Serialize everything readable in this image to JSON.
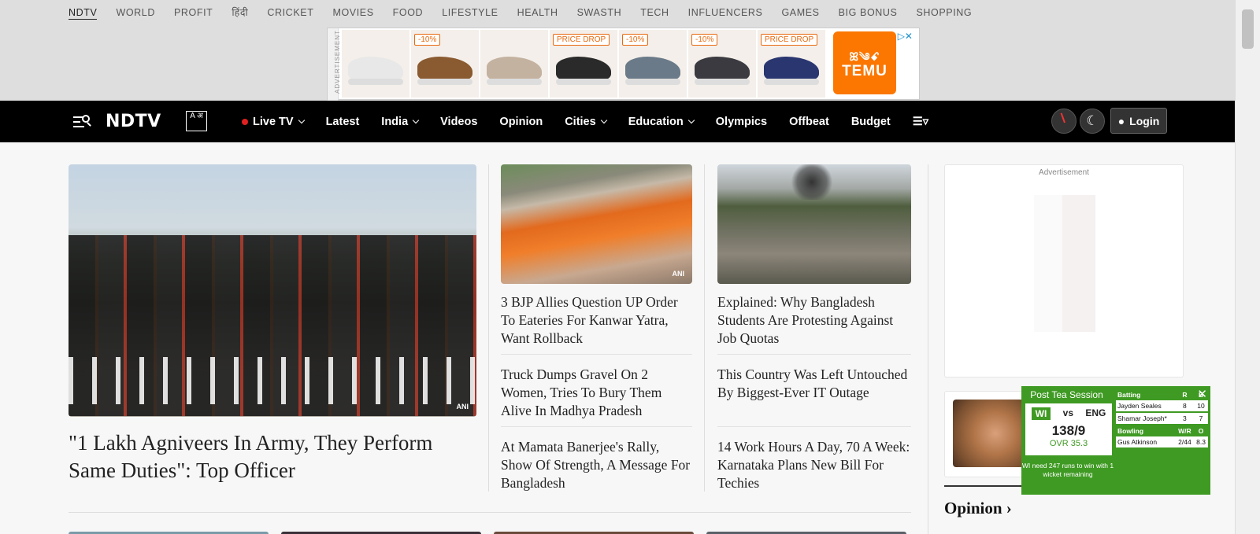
{
  "top_nav": [
    "NDTV",
    "WORLD",
    "PROFIT",
    "हिंदी",
    "CRICKET",
    "MOVIES",
    "FOOD",
    "LIFESTYLE",
    "HEALTH",
    "SWASTH",
    "TECH",
    "INFLUENCERS",
    "GAMES",
    "BIG BONUS",
    "SHOPPING"
  ],
  "ad_banner": {
    "label": "ADVERTISEMENT",
    "products": [
      {
        "tag": "",
        "color": "#e8e8e8"
      },
      {
        "tag": "-10%",
        "color": "#8a5a30"
      },
      {
        "tag": "",
        "color": "#c4b2a0"
      },
      {
        "tag": "PRICE DROP",
        "color": "#2a2a2a"
      },
      {
        "tag": "-10%",
        "color": "#6a7a88"
      },
      {
        "tag": "-10%",
        "color": "#3a3a40"
      },
      {
        "tag": "PRICE DROP",
        "color": "#2a3670"
      }
    ],
    "brand": "TEMU",
    "brand_glyphs": "ꕤ༄ꗃ"
  },
  "header": {
    "logo": "NDTV",
    "lang_badge": "A अ",
    "nav": [
      {
        "label": "Live TV",
        "dot": true,
        "dropdown": true
      },
      {
        "label": "Latest",
        "dropdown": false
      },
      {
        "label": "India",
        "dropdown": true
      },
      {
        "label": "Videos",
        "dropdown": false
      },
      {
        "label": "Opinion",
        "dropdown": false
      },
      {
        "label": "Cities",
        "dropdown": true
      },
      {
        "label": "Education",
        "dropdown": true
      },
      {
        "label": "Olympics",
        "dropdown": false
      },
      {
        "label": "Offbeat",
        "dropdown": false
      },
      {
        "label": "Budget",
        "dropdown": false
      }
    ],
    "more_icon": "☰▿",
    "moon_icon": "☾",
    "login_label": "Login"
  },
  "hero": {
    "credit": "ANI",
    "title": "\"1 Lakh Agniveers In Army, They Perform Same Duties\": Top Officer"
  },
  "col2": {
    "stories": [
      "3 BJP Allies Question UP Order To Eateries For Kanwar Yatra, Want Rollback",
      "Truck Dumps Gravel On 2 Women, Tries To Bury Them Alive In Madhya Pradesh",
      "At Mamata Banerjee's Rally, Show Of Strength, A Message For Bangladesh"
    ]
  },
  "col3": {
    "stories": [
      "Explained: Why Bangladesh Students Are Protesting Against Job Quotas",
      "This Country Was Left Untouched By Biggest-Ever IT Outage",
      "14 Work Hours A Day, 70 A Week: Karnataka Plans New Bill For Techies"
    ]
  },
  "sidebar": {
    "ad_label": "Advertisement",
    "opinion_label": "Opinion ›"
  },
  "score": {
    "session": "Post Tea Session",
    "team1": "WI",
    "vs": "vs",
    "team2": "ENG",
    "runs": "138/9",
    "overs": "OVR 35.3",
    "need": "WI need 247 runs to win with 1 wicket remaining",
    "batting_header": [
      "Batting",
      "R",
      "B"
    ],
    "batters": [
      {
        "name": "Jayden Seales",
        "r": "8",
        "b": "10"
      },
      {
        "name": "Shamar Joseph*",
        "r": "3",
        "b": "7"
      }
    ],
    "bowling_header": [
      "Bowling",
      "W/R",
      "O"
    ],
    "bowlers": [
      {
        "name": "Gus Atkinson",
        "wr": "2/44",
        "o": "8.3"
      }
    ],
    "close_icon": "✕"
  }
}
